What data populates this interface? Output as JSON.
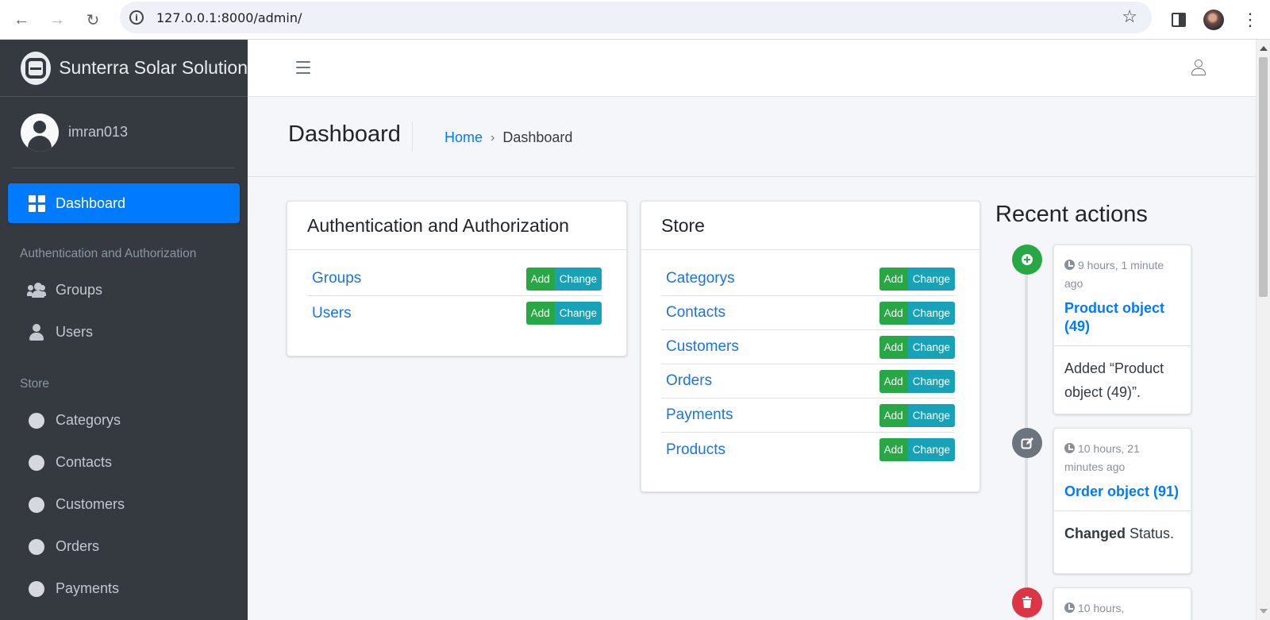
{
  "browser": {
    "url": "127.0.0.1:8000/admin/"
  },
  "sidebar": {
    "brand": "Sunterra Solar Solution",
    "username": "imran013",
    "dashboard_label": "Dashboard",
    "sections": [
      {
        "header": "Authentication and Authorization",
        "items": [
          {
            "label": "Groups",
            "icon": "users-icon"
          },
          {
            "label": "Users",
            "icon": "user-icon"
          }
        ]
      },
      {
        "header": "Store",
        "items": [
          {
            "label": "Categorys",
            "icon": "circle-icon"
          },
          {
            "label": "Contacts",
            "icon": "circle-icon"
          },
          {
            "label": "Customers",
            "icon": "circle-icon"
          },
          {
            "label": "Orders",
            "icon": "circle-icon"
          },
          {
            "label": "Payments",
            "icon": "circle-icon"
          }
        ]
      }
    ]
  },
  "header": {
    "title": "Dashboard",
    "breadcrumb_home": "Home",
    "breadcrumb_sep": "›",
    "breadcrumb_current": "Dashboard"
  },
  "apps": [
    {
      "title": "Authentication and Authorization",
      "models": [
        {
          "name": "Groups",
          "add": "Add",
          "change": "Change"
        },
        {
          "name": "Users",
          "add": "Add",
          "change": "Change"
        }
      ]
    },
    {
      "title": "Store",
      "models": [
        {
          "name": "Categorys",
          "add": "Add",
          "change": "Change"
        },
        {
          "name": "Contacts",
          "add": "Add",
          "change": "Change"
        },
        {
          "name": "Customers",
          "add": "Add",
          "change": "Change"
        },
        {
          "name": "Orders",
          "add": "Add",
          "change": "Change"
        },
        {
          "name": "Payments",
          "add": "Add",
          "change": "Change"
        },
        {
          "name": "Products",
          "add": "Add",
          "change": "Change"
        }
      ]
    }
  ],
  "recent_actions": {
    "title": "Recent actions",
    "items": [
      {
        "type": "add",
        "icon": "plus-circle-icon",
        "color": "#28a745",
        "time": "9 hours, 1 minute ago",
        "object": "Product object (49)",
        "message": "Added “Product object (49)”."
      },
      {
        "type": "change",
        "icon": "edit-icon",
        "color": "#6c757d",
        "time": "10 hours, 21 minutes ago",
        "object": "Order object (91)",
        "message_bold": "Changed",
        "message_rest": " Status."
      },
      {
        "type": "delete",
        "icon": "trash-icon",
        "color": "#dc3545",
        "time": "10 hours,"
      }
    ]
  },
  "colors": {
    "sidebar_bg": "#343a40",
    "primary": "#007bff",
    "add_button": "#28a745",
    "change_button": "#17a2b8"
  }
}
